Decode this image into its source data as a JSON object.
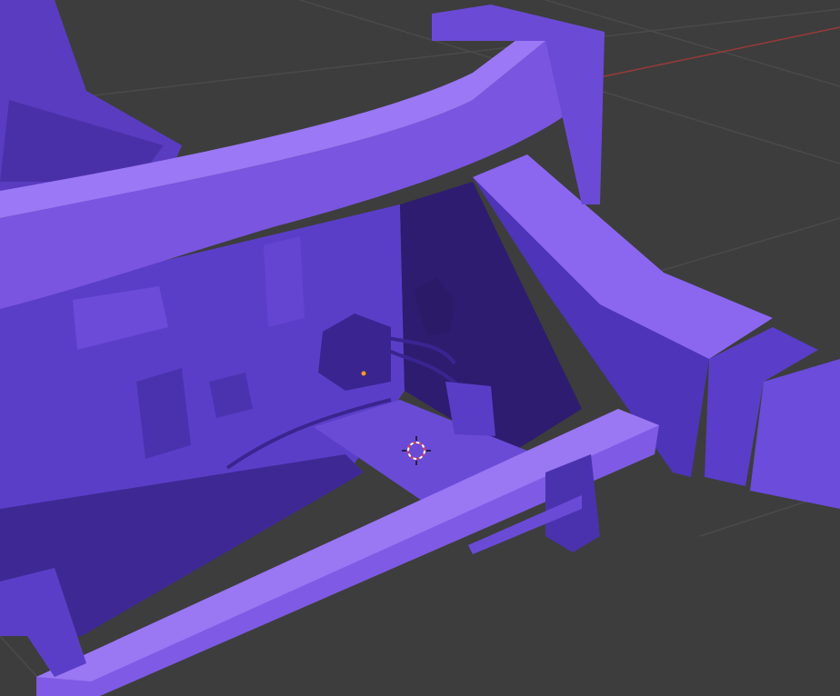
{
  "viewport": {
    "background_color": "#3d3d3d",
    "grid_color": "#4a4a4a",
    "x_axis_color": "#9a3a3a",
    "model_color": "#7a55e0",
    "model_shadow_color": "#3b2590",
    "model_highlight_color": "#9b78f5",
    "cursor_color": "#e04040"
  }
}
